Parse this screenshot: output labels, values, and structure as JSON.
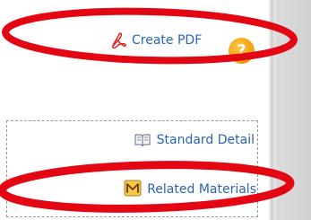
{
  "toolbar": {
    "create_pdf_label": "Create PDF",
    "help_label": "?"
  },
  "links": {
    "standard_detail_label": "Standard Detail",
    "related_materials_label": "Related Materials"
  },
  "icons": {
    "pdf": "pdf-icon",
    "help": "help-icon",
    "book": "book-icon",
    "materials": "m-icon"
  },
  "colors": {
    "link": "#2a64b4",
    "annotation": "#e30613",
    "help": "#f2a012",
    "pdf": "#d8251c"
  }
}
